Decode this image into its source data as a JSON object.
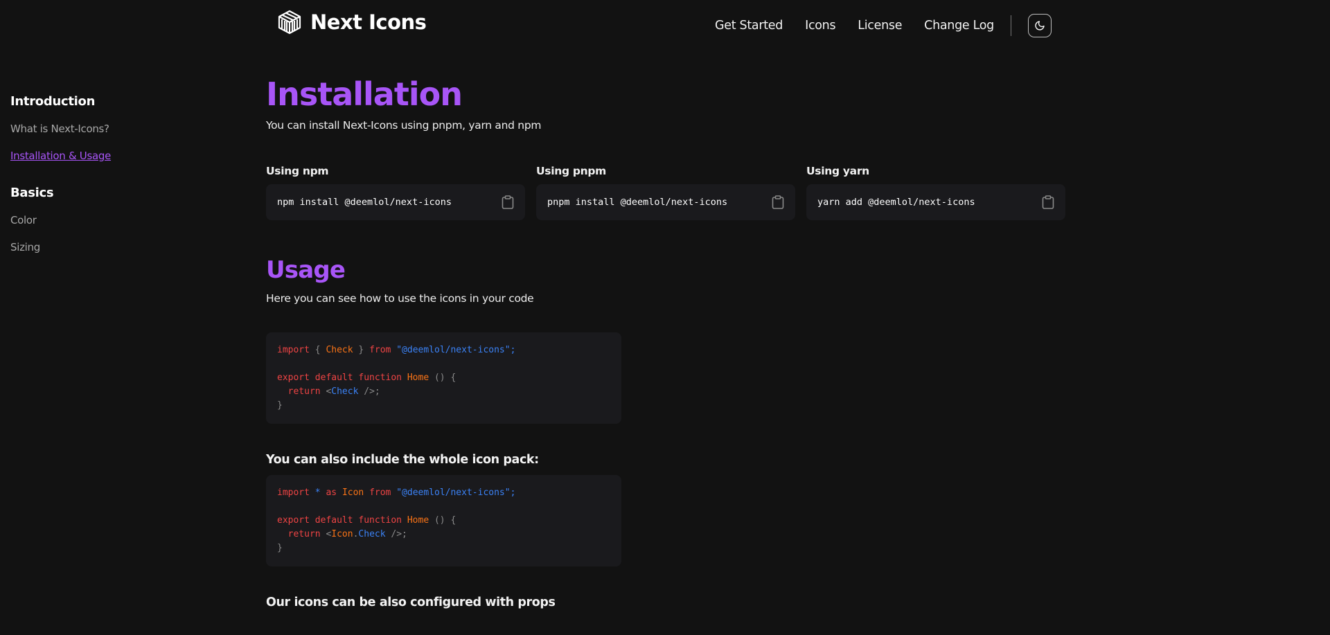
{
  "header": {
    "brand": "Next Icons",
    "nav": [
      "Get Started",
      "Icons",
      "License",
      "Change Log"
    ],
    "theme_icon": "moon-icon",
    "logo_icon": "cube-logo-icon"
  },
  "sidebar": {
    "groups": [
      {
        "heading": "Introduction",
        "items": [
          "What is Next-Icons?",
          "Installation & Usage"
        ]
      },
      {
        "heading": "Basics",
        "items": [
          "Color",
          "Sizing"
        ]
      }
    ],
    "active_item": "Installation & Usage"
  },
  "main": {
    "title": "Installation",
    "lead": "You can install Next-Icons using pnpm, yarn and npm",
    "install": [
      {
        "label": "Using npm",
        "command": "npm install @deemlol/next-icons"
      },
      {
        "label": "Using pnpm",
        "command": "pnpm install @deemlol/next-icons"
      },
      {
        "label": "Using yarn",
        "command": "yarn add @deemlol/next-icons"
      }
    ],
    "copy_icon": "clipboard-icon",
    "usage_title": "Usage",
    "usage_lead": "Here you can see how to use the icons in your code",
    "pack_title": "You can also include the whole icon pack:",
    "props_title": "Our icons can be also configured with props",
    "code1": {
      "l1": [
        "import",
        " { ",
        "Check",
        " } ",
        "from",
        " \"@deemlol/next-icons\";"
      ],
      "l3": [
        "export default function",
        " ",
        "Home",
        " () {"
      ],
      "l4": [
        "  return ",
        "<",
        "Check",
        " />;"
      ],
      "l5": "}"
    },
    "code2": {
      "l1": [
        "import",
        " * ",
        "as",
        " ",
        "Icon",
        " ",
        "from",
        " \"@deemlol/next-icons\";"
      ],
      "l3": [
        "export default function",
        " ",
        "Home",
        " () {"
      ],
      "l4": [
        "  return ",
        "<",
        "Icon",
        ".",
        "Check",
        " />;"
      ],
      "l5": "}"
    }
  },
  "colors": {
    "accent": "#a855f7",
    "background": "#121212",
    "code_bg": "#1a1a1d",
    "keyword": "#ef4444",
    "function": "#f97316",
    "string": "#3b82f6"
  }
}
